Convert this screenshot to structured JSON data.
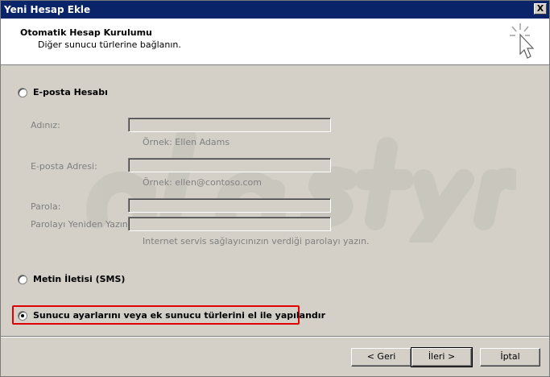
{
  "window": {
    "title": "Yeni Hesap Ekle",
    "close_label": "X"
  },
  "header": {
    "title": "Otomatik Hesap Kurulumu",
    "subtitle": "Diğer sunucu türlerine bağlanın."
  },
  "options": {
    "email": {
      "label": "E-posta Hesabı",
      "name_label": "Adınız:",
      "name_hint": "Örnek: Ellen Adams",
      "email_label": "E-posta Adresi:",
      "email_hint": "Örnek: ellen@contoso.com",
      "password_label": "Parola:",
      "retype_label": "Parolayı Yeniden Yazın:",
      "password_hint": "Internet servis sağlayıcınızın verdiği parolayı yazın."
    },
    "sms": {
      "label": "Metin İletisi (SMS)"
    },
    "manual": {
      "label": "Sunucu ayarlarını veya ek sunucu türlerini el ile yapılandır",
      "selected": true
    }
  },
  "buttons": {
    "back": "< Geri",
    "next": "İleri >",
    "cancel": "İptal"
  },
  "colors": {
    "titlebar": "#0a246a",
    "highlight": "#e00000",
    "face": "#d4d0c8"
  }
}
